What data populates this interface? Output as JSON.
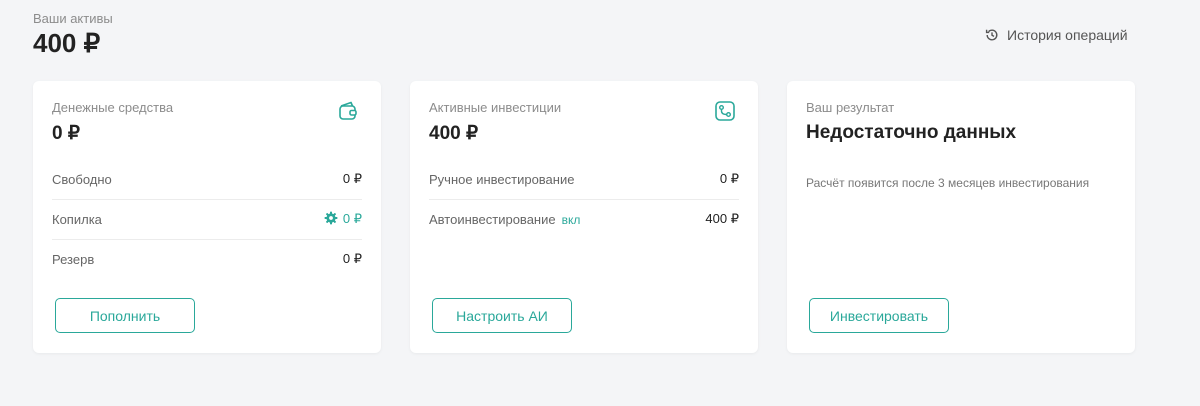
{
  "header": {
    "assets_label": "Ваши активы",
    "assets_total": "400 ₽",
    "history_label": "История операций"
  },
  "cards": {
    "cash": {
      "label": "Денежные средства",
      "value": "0 ₽",
      "icon": "wallet-icon",
      "rows": [
        {
          "label": "Свободно",
          "value": "0 ₽"
        },
        {
          "label": "Копилка",
          "value": "0 ₽",
          "icon": "gear-icon"
        },
        {
          "label": "Резерв",
          "value": "0 ₽"
        }
      ],
      "button": "Пополнить"
    },
    "investments": {
      "label": "Активные инвестиции",
      "value": "400 ₽",
      "icon": "routes-icon",
      "rows": [
        {
          "label": "Ручное инвестирование",
          "value": "0 ₽"
        },
        {
          "label": "Автоинвестирование",
          "tag": "вкл",
          "value": "400 ₽"
        }
      ],
      "button": "Настроить АИ"
    },
    "result": {
      "label": "Ваш результат",
      "value": "Недостаточно данных",
      "note": "Расчёт появится после 3 месяцев инвестирования",
      "button": "Инвестировать"
    }
  },
  "colors": {
    "accent": "#2aa89a",
    "background": "#f4f5f7",
    "card": "#ffffff"
  }
}
